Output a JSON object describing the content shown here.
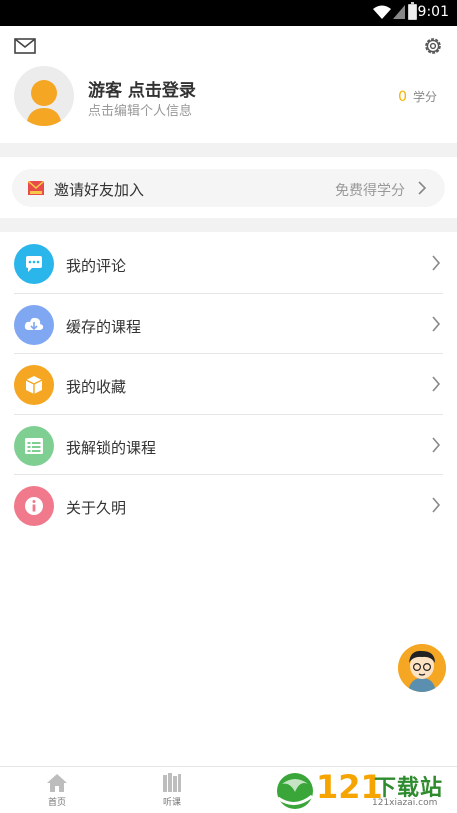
{
  "status_bar": {
    "time": "9:01"
  },
  "profile": {
    "title": "游客 点击登录",
    "subtitle": "点击编辑个人信息",
    "credits_value": "0",
    "credits_unit": "学分"
  },
  "invite": {
    "label": "邀请好友加入",
    "hint": "免费得学分"
  },
  "menu": {
    "items": [
      {
        "label": "我的评论",
        "icon": "comment-icon",
        "color": "#2ab6ea"
      },
      {
        "label": "缓存的课程",
        "icon": "cloud-download-icon",
        "color": "#7fa7f2"
      },
      {
        "label": "我的收藏",
        "icon": "box-icon",
        "color": "#f5a623"
      },
      {
        "label": "我解锁的课程",
        "icon": "list-icon",
        "color": "#7fcf93"
      },
      {
        "label": "关于久明",
        "icon": "info-icon",
        "color": "#f07a8c"
      }
    ]
  },
  "bottom_nav": {
    "tabs": [
      {
        "label": "首页",
        "icon": "home-icon"
      },
      {
        "label": "听课",
        "icon": "books-icon"
      }
    ]
  },
  "watermark": {
    "number": "121",
    "text": "下载站",
    "url": "121xiazai.com"
  }
}
